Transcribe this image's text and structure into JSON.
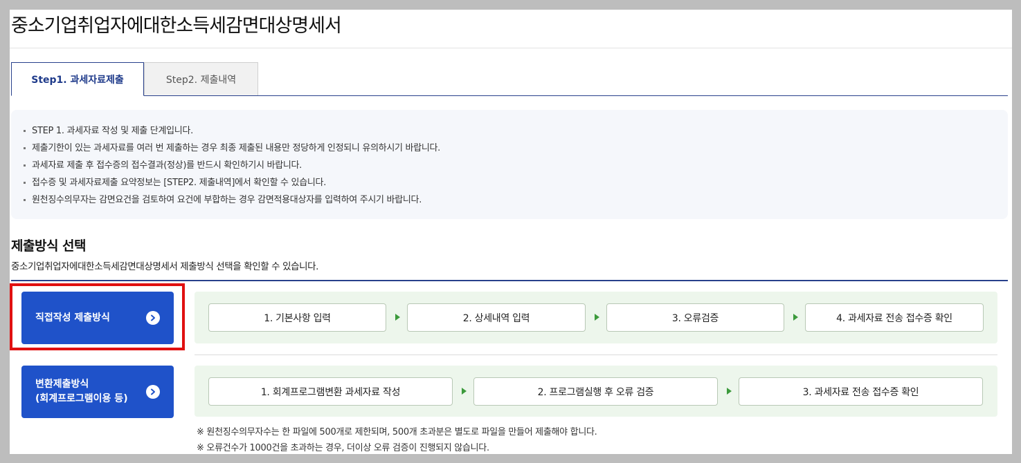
{
  "page": {
    "title": "중소기업취업자에대한소득세감면대상명세서"
  },
  "tabs": [
    {
      "label": "Step1. 과세자료제출",
      "active": true
    },
    {
      "label": "Step2. 제출내역",
      "active": false
    }
  ],
  "notice": {
    "items": [
      "STEP 1. 과세자료 작성 및 제출 단계입니다.",
      "제출기한이 있는 과세자료를 여러 번 제출하는 경우 최종 제출된 내용만 정당하게 인정되니 유의하시기 바랍니다.",
      "과세자료 제출 후 접수증의 접수결과(정상)를 반드시 확인하기시 바랍니다.",
      "접수증 및 과세자료제출 요약정보는 [STEP2. 제출내역]에서 확인할 수 있습니다.",
      "원천징수의무자는 감면요건을 검토하여 요건에 부합하는 경우 감면적용대상자를 입력하여 주시기 바랍니다."
    ]
  },
  "section": {
    "title": "제출방식 선택",
    "description": "중소기업취업자에대한소득세감면대상명세서 제출방식 선택을 확인할 수 있습니다."
  },
  "methods": {
    "direct": {
      "label": "직접작성 제출방식",
      "steps": [
        "1. 기본사항 입력",
        "2. 상세내역 입력",
        "3. 오류검증",
        "4. 과세자료 전송 접수증 확인"
      ]
    },
    "convert": {
      "label_line1": "변환제출방식",
      "label_line2": "(회계프로그램이용 등)",
      "steps": [
        "1. 회계프로그램변환 과세자료 작성",
        "2. 프로그램실행 후 오류 검증",
        "3. 과세자료 전송 접수증 확인"
      ]
    }
  },
  "footnotes": [
    "※ 원천징수의무자수는 한 파일에 500개로 제한되며, 500개 초과분은 별도로 파일을 만들어 제출해야 합니다.",
    "※ 오류건수가 1000건을 초과하는 경우, 더이상 오류 검증이 진행되지 않습니다."
  ],
  "colors": {
    "primary_button": "#1f52c9",
    "tab_accent": "#27408b",
    "step_background": "#edf6ec",
    "step_arrow": "#3c9a3c",
    "highlight_border": "#e01010"
  }
}
